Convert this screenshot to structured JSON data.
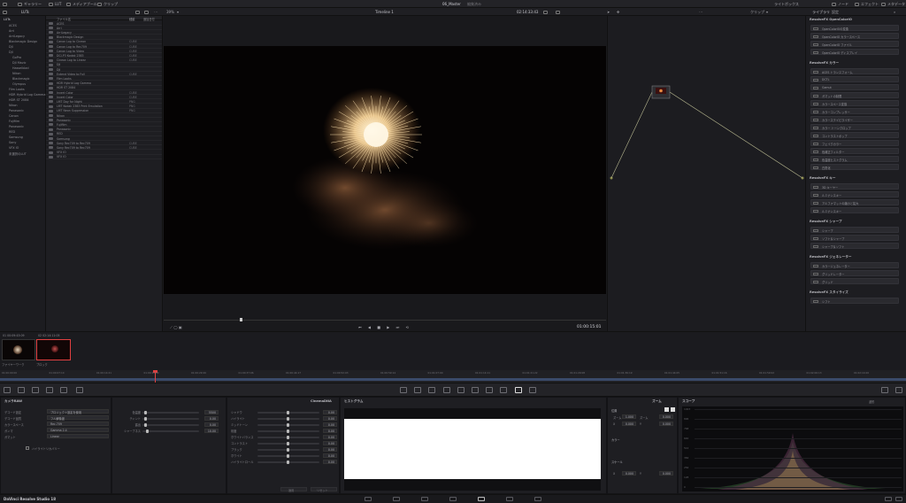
{
  "topbar": {
    "left_items": [
      "ギャラリー",
      "LUT",
      "メディアプール",
      "クリップ"
    ],
    "project_title": "06_Master",
    "project_state": "編集済み",
    "right_items": [
      "ライトボックス",
      "ノード",
      "エフェクト",
      "メタデータ"
    ]
  },
  "toolbar": {
    "luts_label": "LUTs",
    "zoom": "39%",
    "timeline_name": "Timeline 1",
    "timecode": "02:14:33:43",
    "nodes_label": "クリップ",
    "library_label": "ライブラリ",
    "settings_label": "設定"
  },
  "lut_tree": [
    "LUTs",
    "ACES",
    "Arri",
    "ArriLegacy",
    "Blackmagic Design",
    "DJI",
    "DJI",
    "GoPro",
    "DJI Mavic",
    "Hasselblad",
    "Nikon",
    "Blackmagic",
    "Olympus",
    "Film Looks",
    "HDR Hybrid Log Gamma",
    "HDR ST 2084",
    "Nikon",
    "Panasonic",
    "Canon",
    "Fujifilm",
    "Panasonic",
    "RED",
    "Samsung",
    "Sony",
    "VFX IO",
    "未選択のLUT"
  ],
  "file_list": {
    "header_name": "ファイル名",
    "header_size": "種類",
    "header_date": "追加日付",
    "rows": [
      {
        "name": "ACES",
        "type": ""
      },
      {
        "name": "Arri",
        "type": ""
      },
      {
        "name": "ArriLegacy",
        "type": ""
      },
      {
        "name": "Blackmagic Design",
        "type": ""
      },
      {
        "name": "Canon Log to Cineon",
        "type": "CUBE"
      },
      {
        "name": "Canon Log to Rec709",
        "type": "CUBE"
      },
      {
        "name": "Canon Log to Video",
        "type": "CUBE"
      },
      {
        "name": "DCI-P3 Kodak 2383",
        "type": "CUBE"
      },
      {
        "name": "Cineon Log to Linear",
        "type": "CUBE"
      },
      {
        "name": "DJI",
        "type": ""
      },
      {
        "name": "DJI",
        "type": ""
      },
      {
        "name": "Extend Video to Full",
        "type": "CUBE"
      },
      {
        "name": "Film Looks",
        "type": ""
      },
      {
        "name": "HDR Hybrid Log Gamma",
        "type": ""
      },
      {
        "name": "HDR ST 2084",
        "type": ""
      },
      {
        "name": "Invert Color",
        "type": "CUBE"
      },
      {
        "name": "Invert Color",
        "type": "CUBE"
      },
      {
        "name": "LMT Day for Night",
        "type": "PNG"
      },
      {
        "name": "LMT Kodak 2383 Print Emulation",
        "type": "PNG"
      },
      {
        "name": "LMT Neon Suppression",
        "type": "PNG"
      },
      {
        "name": "Nikon",
        "type": ""
      },
      {
        "name": "Panasonic",
        "type": ""
      },
      {
        "name": "Fujifilm",
        "type": ""
      },
      {
        "name": "Panasonic",
        "type": ""
      },
      {
        "name": "RED",
        "type": ""
      },
      {
        "name": "Samsung",
        "type": ""
      },
      {
        "name": "Sony Rec709 to Rec709",
        "type": "CUBE"
      },
      {
        "name": "Sony Rec709 to Rec709",
        "type": "CUBE"
      },
      {
        "name": "VFX IO",
        "type": ""
      },
      {
        "name": "VFX IO",
        "type": ""
      }
    ]
  },
  "viewer": {
    "timecode": "01:00:15:01"
  },
  "fx_library": {
    "sections": [
      {
        "title": "ResolveFX OpenColorIO",
        "items": [
          "OpenColorIOの変換",
          "OpenColorIO カラースペース",
          "OpenColorIO ファイル",
          "OpenColorIO ディスプレイ"
        ]
      },
      {
        "title": "ResolveFX カラー",
        "items": [
          "ACES トランスフォーム",
          "DCTL",
          "Gamut",
          "ガマットの制限",
          "カラースペース変換",
          "カラーコンプレッサー",
          "カラーステイビライザー",
          "カラー トーンクロップ",
          "コントラストポップ",
          "フェイクカラー",
          "色補正フィルター",
          "色温度ヒストグラム",
          "白黒化"
        ]
      },
      {
        "title": "ResolveFX キー",
        "items": [
          "3D キーヤー",
          "ルミナンスキー",
          "アルファマットの縮小と拡大",
          "ルミナンスキー"
        ]
      },
      {
        "title": "ResolveFX シャープ",
        "items": [
          "シャープ",
          "ソフト＆シャープ",
          "シャープ＆ソフト"
        ]
      },
      {
        "title": "ResolveFX ジェネレーター",
        "items": [
          "カラージェネレーター",
          "グリッドレーター",
          "グリッド"
        ]
      },
      {
        "title": "ResolveFX スタイライズ",
        "items": [
          "シフト"
        ]
      }
    ]
  },
  "clips": [
    {
      "label": "01",
      "timecode": "00:09:43:09",
      "name": "ファイヤーワーク"
    },
    {
      "label": "02",
      "timecode": "02:14:11:05",
      "name": "ブロック"
    }
  ],
  "timeline_ticks": [
    "01:00:00:00",
    "01:00:07:10",
    "01:00:14:21",
    "01:00:22:09",
    "01:00:29:20",
    "01:00:37:06",
    "01:00:44:17",
    "01:00:52:03",
    "01:00:59:14",
    "01:01:07:00",
    "01:01:14:11",
    "01:01:21:22",
    "01:01:29:08",
    "01:01:36:19",
    "01:01:44:05",
    "01:01:51:16",
    "01:01:59:02",
    "01:02:06:13",
    "01:02:14:00"
  ],
  "color_panel": {
    "title": "カメラRAW",
    "decode_label": "デコード設定",
    "decode_value": "プロジェクト設定を使用",
    "items": [
      {
        "label": "デコード品質",
        "value": "フル解像度"
      },
      {
        "label": "カラースペース",
        "value": "Rec.709"
      },
      {
        "label": "ガンマ",
        "value": "Gamma 2.4"
      },
      {
        "label": "ガマット",
        "value": "Linear"
      }
    ],
    "checkbox_label": "ハイライトリカバリー"
  },
  "basic_params": [
    {
      "label": "色温度",
      "value": "5500"
    },
    {
      "label": "ティント",
      "value": "0.00"
    },
    {
      "label": "露出",
      "value": "0.00"
    },
    {
      "label": "シャープネス",
      "value": "10.00"
    }
  ],
  "adjust_params": {
    "title": "CinemaDNA",
    "items": [
      {
        "label": "シャドウ",
        "value": "0.00"
      },
      {
        "label": "ハイライト",
        "value": "0.00"
      },
      {
        "label": "ミッドトーン",
        "value": "0.00"
      },
      {
        "label": "彩度",
        "value": "0.00"
      },
      {
        "label": "ホワイトバランス",
        "value": "0.00"
      },
      {
        "label": "コントラスト",
        "value": "0.00"
      },
      {
        "label": "ブラック",
        "value": "0.00"
      },
      {
        "label": "ホワイト",
        "value": "0.00"
      },
      {
        "label": "ハイライトロール",
        "value": "0.00"
      }
    ],
    "apply_button": "適用",
    "reset_button": "リセット"
  },
  "scope_left": {
    "title": "ヒストグラム"
  },
  "zoom_panel": {
    "title": "ズーム",
    "sub1": "位置",
    "sub2": "カラー",
    "sub3": "スケール",
    "fields": [
      {
        "label": "ズーム",
        "value": "1.000"
      },
      {
        "label": "ズーム",
        "value": "0.000"
      },
      {
        "label": "X",
        "value": "0.000"
      },
      {
        "label": "Y",
        "value": "0.000"
      },
      {
        "label": "X",
        "value": "0.000"
      },
      {
        "label": "Y",
        "value": "0.000"
      }
    ]
  },
  "scope": {
    "title": "スコープ",
    "mode": "波形",
    "labels": [
      "1023",
      "896",
      "768",
      "640",
      "512",
      "384",
      "256",
      "128",
      "0"
    ]
  },
  "statusbar": {
    "app_name": "DaVinci Resolve Studio 18"
  }
}
